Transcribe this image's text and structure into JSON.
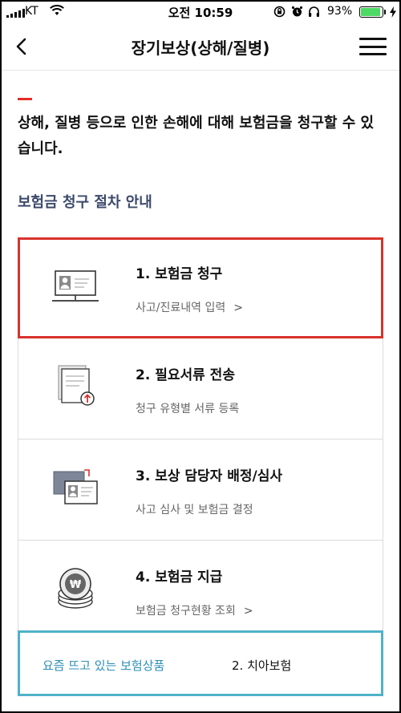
{
  "status_bar": {
    "carrier": "KT",
    "time": "오전 10:59",
    "battery_percent": "93%",
    "battery_level": 0.93,
    "icons": [
      "signal-icon",
      "wifi-icon",
      "rotation-lock-icon",
      "alarm-icon",
      "headphones-icon",
      "battery-icon",
      "charging-bolt-icon"
    ],
    "battery_color": "#4cd964"
  },
  "nav": {
    "title": "장기보상(상해/질병)",
    "back_icon": "chevron-left-icon",
    "menu_icon": "hamburger-menu-icon"
  },
  "intro": {
    "text": "상해, 질병 등으로 인한 손해에 대해 보험금을 청구할 수 있습니다.",
    "accent_color": "#e52d27"
  },
  "section_title": "보험금 청구 절차 안내",
  "steps": [
    {
      "label": "1. 보험금 청구",
      "sub": "사고/진료내역 입력",
      "chevron": ">",
      "icon": "monitor-profile-icon",
      "highlight_color": "#d9322b"
    },
    {
      "label": "2. 필요서류 전송",
      "sub": "청구 유형별 서류 등록",
      "icon": "document-upload-icon"
    },
    {
      "label": "3. 보상 담당자 배정/심사",
      "sub": "사고 심사 및 보험금 결정",
      "icon": "id-card-assign-icon"
    },
    {
      "label": "4. 보험금 지급",
      "sub": "보험금 청구현황 조회",
      "chevron": ">",
      "icon": "won-coin-stack-icon"
    }
  ],
  "banner": {
    "lead": "요즘 뜨고 있는 보험상품",
    "item": "2. 치아보험",
    "border_color": "#4fb2c8"
  }
}
